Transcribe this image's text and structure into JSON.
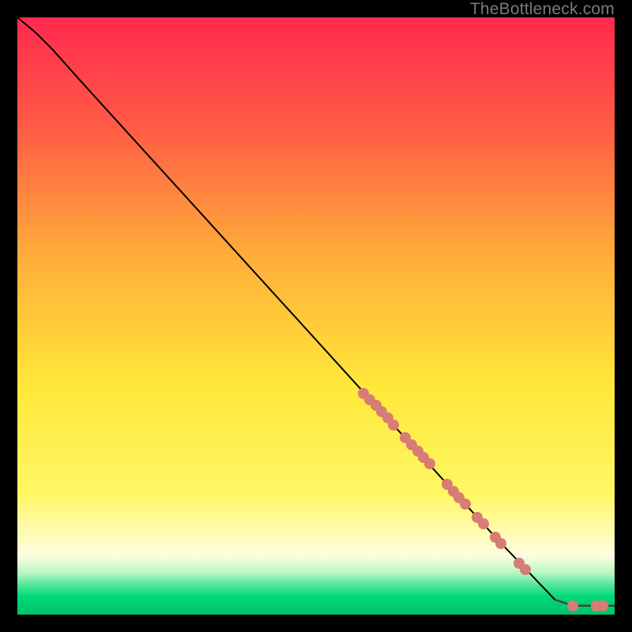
{
  "watermark": "TheBottleneck.com",
  "chart_data": {
    "type": "line",
    "title": "",
    "xlabel": "",
    "ylabel": "",
    "xlim": [
      0,
      100
    ],
    "ylim": [
      0,
      100
    ],
    "gradient_colors": {
      "top": "#ff2a4f",
      "mid1": "#ff7a3a",
      "mid2": "#ffe83a",
      "low": "#fffde0",
      "bottom": "#00e57a",
      "bottom2": "#00c76a"
    },
    "curve": [
      {
        "x": 0,
        "y": 100
      },
      {
        "x": 3,
        "y": 97.5
      },
      {
        "x": 6,
        "y": 94.5
      },
      {
        "x": 10,
        "y": 90
      },
      {
        "x": 20,
        "y": 79
      },
      {
        "x": 30,
        "y": 68
      },
      {
        "x": 40,
        "y": 57
      },
      {
        "x": 50,
        "y": 46
      },
      {
        "x": 60,
        "y": 35
      },
      {
        "x": 70,
        "y": 24
      },
      {
        "x": 80,
        "y": 13
      },
      {
        "x": 90,
        "y": 2.5
      },
      {
        "x": 93,
        "y": 1.5
      },
      {
        "x": 96,
        "y": 1.5
      },
      {
        "x": 100,
        "y": 1.5
      }
    ],
    "points": [
      {
        "x": 58,
        "y": 37
      },
      {
        "x": 59,
        "y": 36
      },
      {
        "x": 60,
        "y": 35
      },
      {
        "x": 61,
        "y": 34
      },
      {
        "x": 62,
        "y": 33
      },
      {
        "x": 63,
        "y": 31.8
      },
      {
        "x": 65,
        "y": 29.6
      },
      {
        "x": 66,
        "y": 28.5
      },
      {
        "x": 67,
        "y": 27.4
      },
      {
        "x": 68,
        "y": 26.3
      },
      {
        "x": 69,
        "y": 25.2
      },
      {
        "x": 72,
        "y": 21.8
      },
      {
        "x": 73,
        "y": 20.7
      },
      {
        "x": 74,
        "y": 19.6
      },
      {
        "x": 75,
        "y": 18.5
      },
      {
        "x": 77,
        "y": 16.3
      },
      {
        "x": 78,
        "y": 15.2
      },
      {
        "x": 80,
        "y": 13.0
      },
      {
        "x": 81,
        "y": 11.9
      },
      {
        "x": 84,
        "y": 8.6
      },
      {
        "x": 85,
        "y": 7.5
      },
      {
        "x": 93,
        "y": 1.5
      },
      {
        "x": 97,
        "y": 1.5
      },
      {
        "x": 98,
        "y": 1.5
      }
    ]
  }
}
